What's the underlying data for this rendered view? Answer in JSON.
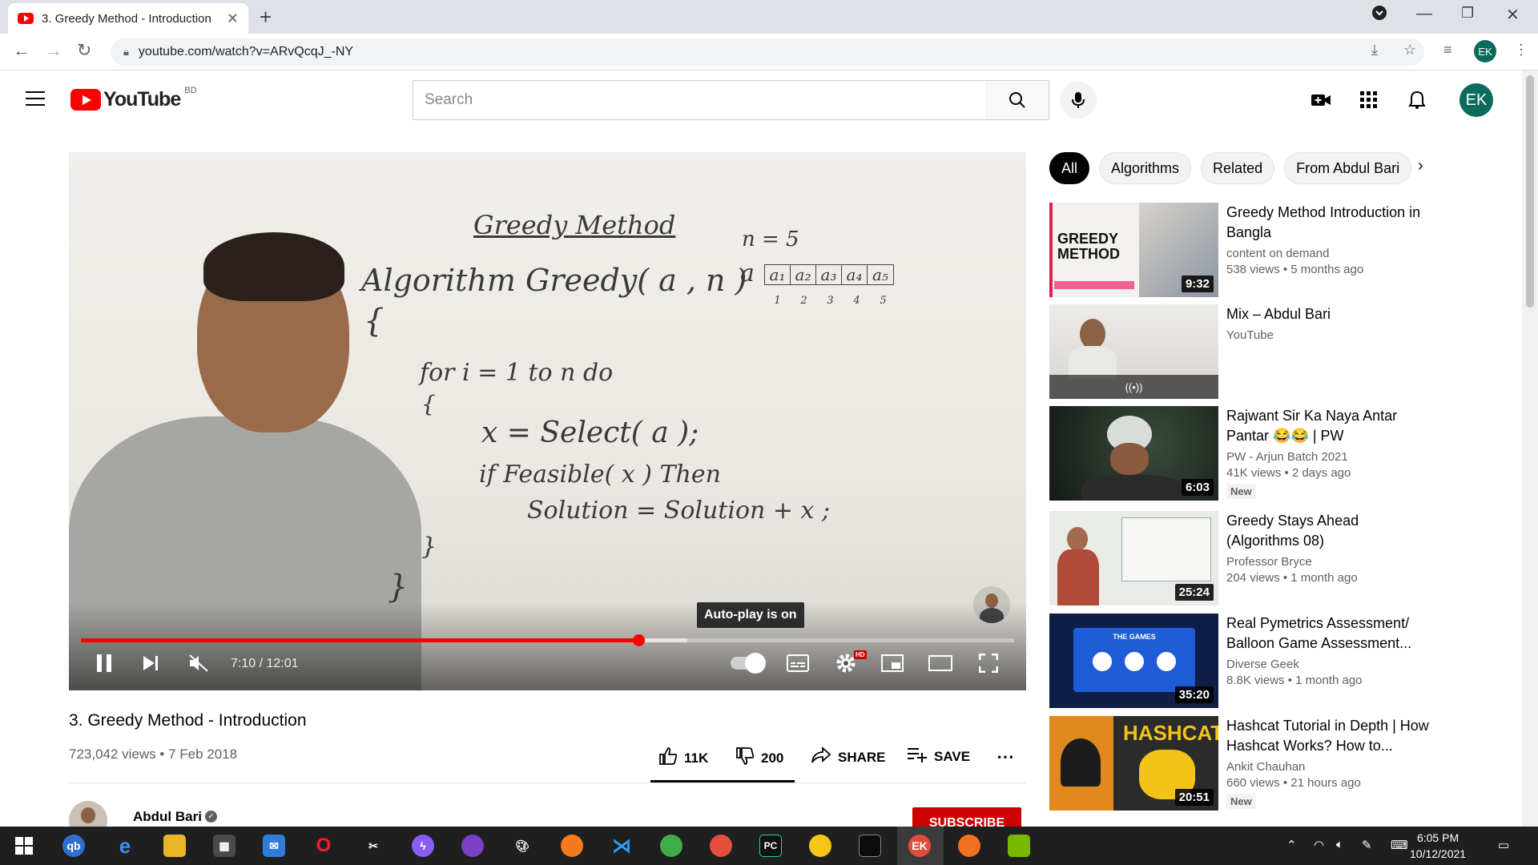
{
  "browser": {
    "tab_title": "3. Greedy Method - Introduction",
    "url": "youtube.com/watch?v=ARvQcqJ_-NY",
    "profile_initials": "EK"
  },
  "header": {
    "logo_text": "YouTube",
    "region": "BD",
    "search_placeholder": "Search",
    "avatar_initials": "EK"
  },
  "player": {
    "board": {
      "heading": "Greedy Method",
      "algorithm_line": "Algorithm Greedy( a , n )",
      "n_equals": "n = 5",
      "array_label": "a",
      "array_cells": [
        "a₁",
        "a₂",
        "a₃",
        "a₄",
        "a₅"
      ],
      "array_indices": [
        "1",
        "2",
        "3",
        "4",
        "5"
      ],
      "open_brace": "{",
      "for_line": "for i = 1 to n do",
      "inner_brace": "{",
      "select_line": "x = Select( a );",
      "feasible_line": "if Feasible( x ) Then",
      "solution_line": "Solution = Solution + x ;",
      "close_inner": "}",
      "close_outer": "}"
    },
    "tooltip": "Auto-play is on",
    "time": "7:10 / 12:01",
    "progress_fraction": 0.597,
    "buffer_fraction": 0.65,
    "hd_label": "HD"
  },
  "video": {
    "title": "3. Greedy Method - Introduction",
    "meta": "723,042 views • 7 Feb 2018",
    "likes": "11K",
    "dislikes": "200",
    "share_label": "SHARE",
    "save_label": "SAVE",
    "channel_name": "Abdul Bari",
    "subscribe_label": "SUBSCRIBE"
  },
  "chips": [
    "All",
    "Algorithms",
    "Related",
    "From Abdul Bari"
  ],
  "recommendations": [
    {
      "title": "Greedy Method Introduction in Bangla",
      "channel": "content on demand",
      "views": "538 views • 5 months ago",
      "duration": "9:32",
      "new": false,
      "thumb_text": "GREEDY METHOD"
    },
    {
      "title": "Mix – Abdul Bari",
      "channel": "YouTube",
      "views": "",
      "duration": "",
      "new": false,
      "mix_icon": "((•))"
    },
    {
      "title": "Rajwant Sir Ka Naya Antar Pantar 😂😂 | PW",
      "channel": "PW - Arjun Batch 2021",
      "views": "41K views • 2 days ago",
      "duration": "6:03",
      "new": true
    },
    {
      "title": "Greedy Stays Ahead (Algorithms 08)",
      "channel": "Professor Bryce",
      "views": "204 views • 1 month ago",
      "duration": "25:24",
      "new": false
    },
    {
      "title": "Real Pymetrics Assessment/ Balloon Game Assessment...",
      "channel": "Diverse Geek",
      "views": "8.8K views • 1 month ago",
      "duration": "35:20",
      "new": false,
      "thumb_text": "THE GAMES"
    },
    {
      "title": "Hashcat Tutorial in Depth | How Hashcat Works? How to...",
      "channel": "Ankit Chauhan",
      "views": "660 views • 21 hours ago",
      "duration": "20:51",
      "new": true,
      "thumb_text": "HASHCAT"
    }
  ],
  "new_badge": "New",
  "taskbar": {
    "time": "6:05 PM",
    "date": "10/12/2021"
  }
}
